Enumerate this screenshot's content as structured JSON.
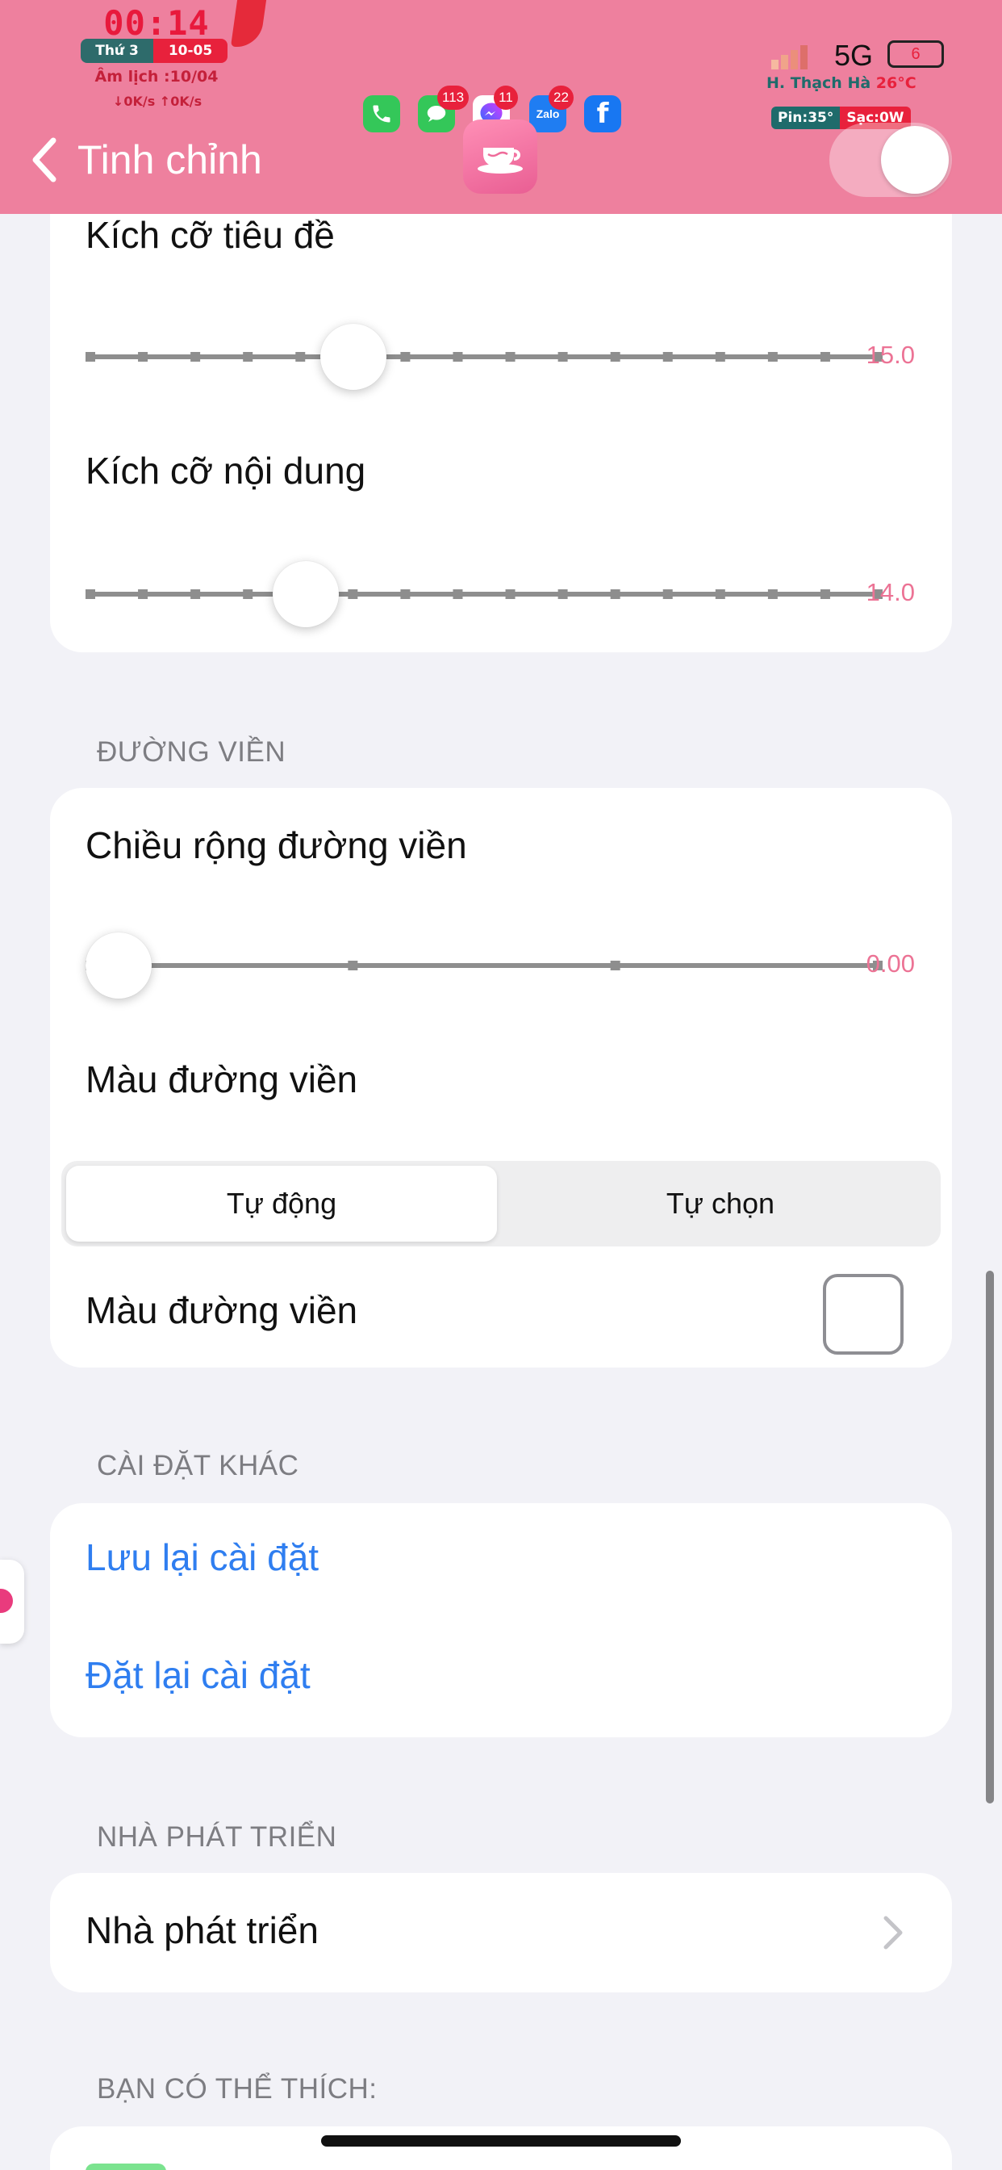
{
  "status_bar": {
    "time": "00:14",
    "weekday": "Thứ 3",
    "date": "10-05",
    "lunar_prefix": "Âm lịch :",
    "lunar_date": "10/04",
    "net_speed": "↓0K/s ↑0K/s",
    "network": "5G",
    "battery": "6",
    "location": "H. Thạch Hà",
    "temperature": "26°C",
    "battery_temp": "Pin:35°",
    "charging": "Sạc:0W",
    "notification_badges": {
      "messages": "113",
      "messenger": "11",
      "zalo": "22"
    },
    "zalo_label": "Zalo"
  },
  "nav": {
    "back_label": "Tinh chỉnh",
    "toggle_on": true
  },
  "typography_card": {
    "title_size_label": "Kích cỡ tiêu đề",
    "title_size_value": "15.0",
    "title_size_fraction": 0.33,
    "content_size_label": "Kích cỡ nội dung",
    "content_size_value": "14.0",
    "content_size_fraction": 0.27
  },
  "border_section": {
    "header": "ĐƯỜNG VIỀN",
    "width_label": "Chiều rộng đường viền",
    "width_value": "0.00",
    "width_fraction": 0.0,
    "color_label": "Màu đường viền",
    "segments": [
      "Tự động",
      "Tự chọn"
    ],
    "selected_segment": "Tự động",
    "color_row_label": "Màu đường viền"
  },
  "other_section": {
    "header": "CÀI ĐẶT KHÁC",
    "save_label": "Lưu lại cài đặt",
    "reset_label": "Đặt lại cài đặt"
  },
  "developer_section": {
    "header": "NHÀ PHÁT TRIỂN",
    "developer_label": "Nhà phát triển"
  },
  "suggest_section": {
    "header": "BẠN CÓ THỂ THÍCH:"
  },
  "colors": {
    "header_pink": "#ee809e",
    "accent_pink": "#ec7395",
    "link_blue": "#2f7ef0"
  }
}
